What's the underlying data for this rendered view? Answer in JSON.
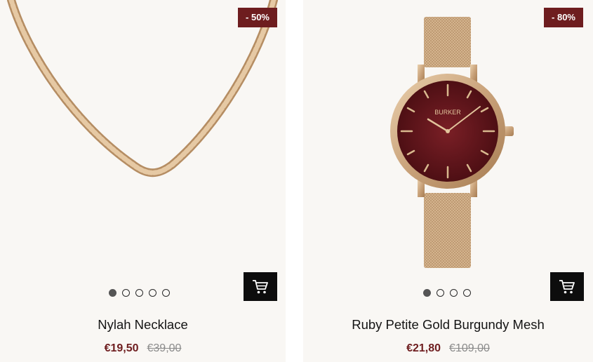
{
  "products": [
    {
      "discount_badge": "- 50%",
      "name": "Nylah Necklace",
      "sale_price": "€19,50",
      "original_price": "€39,00",
      "image_dots": 5,
      "active_dot": 0,
      "cart_icon": "shopping-cart-icon"
    },
    {
      "discount_badge": "- 80%",
      "name": "Ruby Petite Gold Burgundy Mesh",
      "sale_price": "€21,80",
      "original_price": "€109,00",
      "image_dots": 4,
      "active_dot": 0,
      "cart_icon": "shopping-cart-icon",
      "watch_brand": "BURKER"
    }
  ],
  "colors": {
    "badge": "#6e1d1f",
    "sale_price": "#6e1d1f",
    "card_background": "#f9f7f4",
    "cart_button": "#0d0d0d",
    "gold": "#c9a27a"
  }
}
